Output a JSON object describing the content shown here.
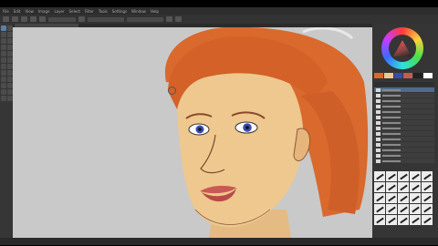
{
  "menubar": {
    "items": [
      "File",
      "Edit",
      "View",
      "Image",
      "Layer",
      "Select",
      "Filter",
      "Tools",
      "Settings",
      "Window",
      "Help"
    ]
  },
  "toolbar": {
    "opacity_label": "",
    "size_label": ""
  },
  "canvas": {
    "description_tab": ""
  },
  "status": {
    "left": "",
    "right": ""
  },
  "colors": {
    "canvas_bg": "#c9c9c9",
    "hair": "#d9692c",
    "skin": "#eec88e",
    "eyes": "#3a4bb0",
    "lips": "#c85a55"
  },
  "icons": [
    "color-wheel-icon",
    "brush-preset-icon",
    "layer-thumbnail-icon",
    "brush-cursor-icon"
  ]
}
